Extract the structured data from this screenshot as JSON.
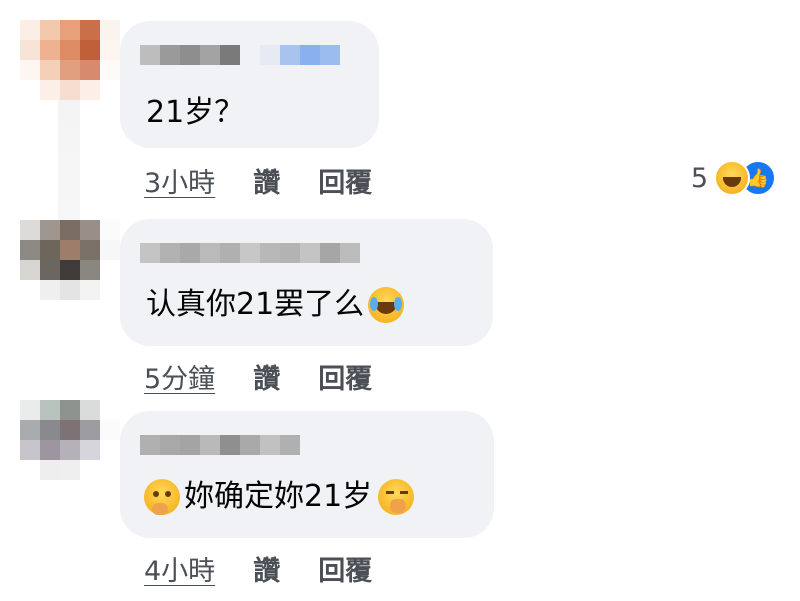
{
  "comments": [
    {
      "text": "21岁？",
      "time": "3小時",
      "like_label": "讚",
      "reply_label": "回覆",
      "reaction_count": "5",
      "reaction_icons": [
        "haha-reaction-icon",
        "like-reaction-icon"
      ]
    },
    {
      "text": "认真你21罢了么",
      "trailing_emoji": "laughing-crying-emoji-icon",
      "time": "5分鐘",
      "like_label": "讚",
      "reply_label": "回覆"
    },
    {
      "leading_emoji": "thinking-face-emoji-icon",
      "text": "妳确定妳21岁",
      "trailing_emoji": "yawning-face-emoji-icon",
      "time": "4小時",
      "like_label": "讚",
      "reply_label": "回覆"
    }
  ],
  "colors": {
    "bubble": "#f0f2f5",
    "action_text": "#4b4f56",
    "like_blue": "#1877f2",
    "emoji_yellow": "#f6b627"
  }
}
